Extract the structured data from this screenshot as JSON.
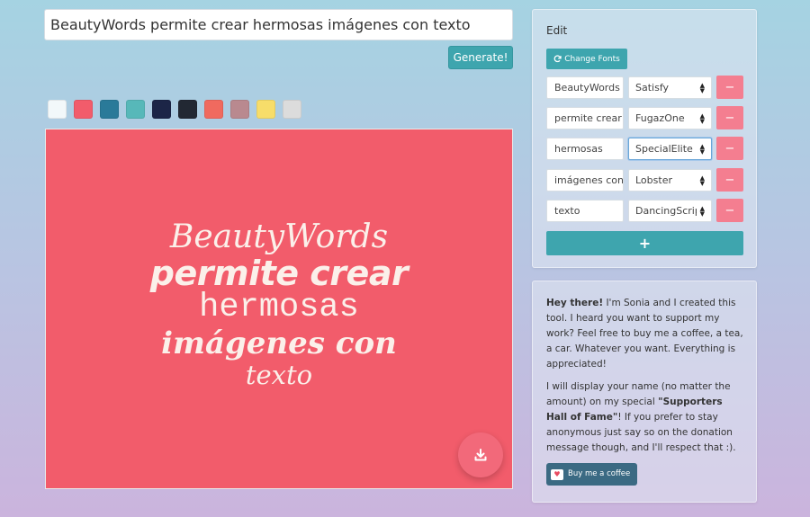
{
  "input": {
    "value": "BeautyWords permite crear hermosas imágenes con texto"
  },
  "generate_label": "Generate!",
  "colors": [
    "#f2f8fa",
    "#f25c6b",
    "#2a7a99",
    "#57b8b9",
    "#1c2547",
    "#222833",
    "#f06a5f",
    "#b9898f",
    "#f7dd6a",
    "#dcdcdc"
  ],
  "canvas": {
    "background": "#f25c6b",
    "lines": [
      "BeautyWords",
      "permite crear",
      "hermosas",
      "imágenes con",
      "texto"
    ]
  },
  "edit": {
    "title": "Edit",
    "change_fonts_label": "Change Fonts",
    "rows": [
      {
        "word": "BeautyWords",
        "font": "Satisfy"
      },
      {
        "word": "permite crear",
        "font": "FugazOne"
      },
      {
        "word": "hermosas",
        "font": "SpecialElite"
      },
      {
        "word": "imágenes con",
        "font": "Lobster"
      },
      {
        "word": "texto",
        "font": "DancingScript"
      }
    ],
    "add_label": "+",
    "remove_label": "−"
  },
  "about": {
    "greeting": "Hey there!",
    "p1_rest": " I'm Sonia and I created this tool. I heard you want to support my work? Feel free to buy me a coffee, a tea, a car. Whatever you want. Everything is appreciated!",
    "p2_a": "I will display your name (no matter the amount) on my special ",
    "p2_b": "\"Supporters Hall of Fame\"",
    "p2_c": "! If you prefer to stay anonymous just say so on the donation message though, and I'll respect that :).",
    "bmc_label": "Buy me a coffee"
  }
}
